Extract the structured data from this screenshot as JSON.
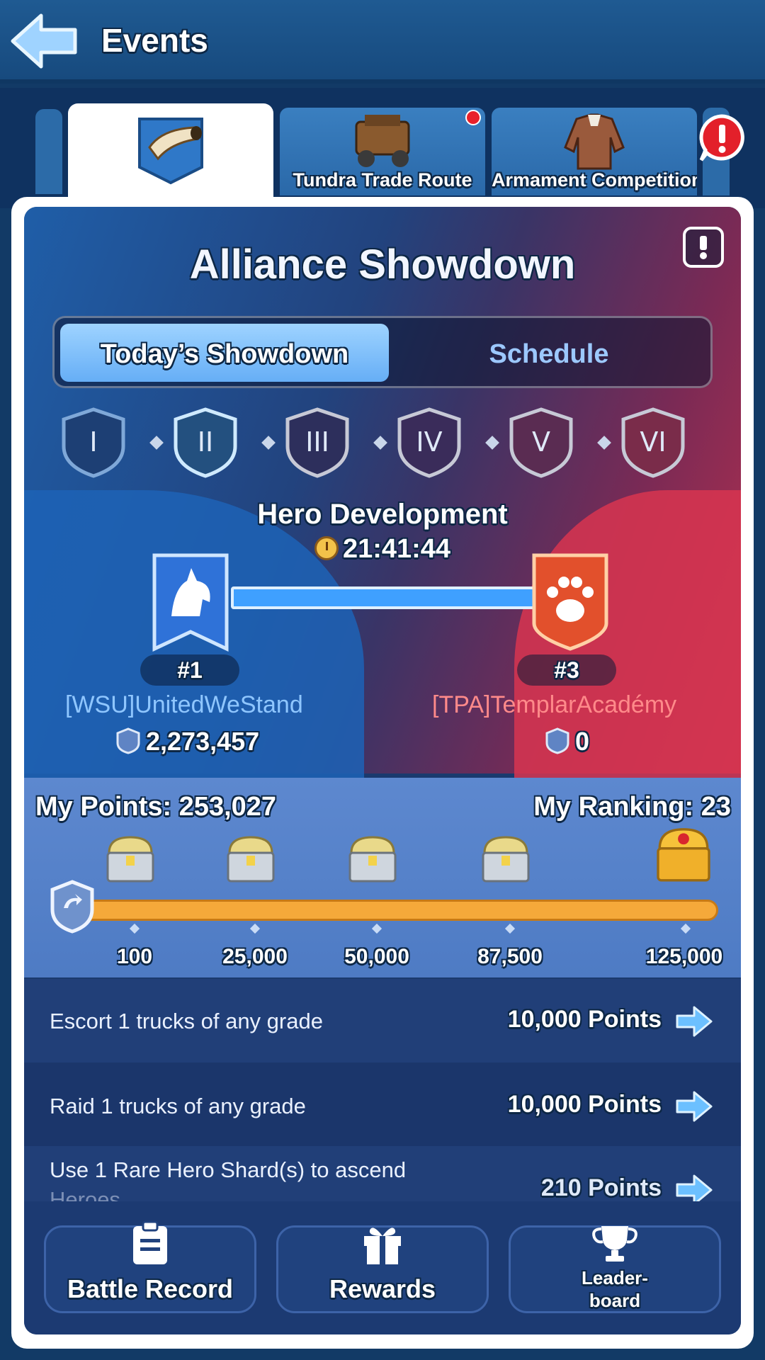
{
  "header": {
    "title": "Events"
  },
  "tabs": [
    {
      "label": "",
      "icon": "horn-icon",
      "active": true
    },
    {
      "label": "Tundra Trade Route",
      "icon": "truck-icon",
      "has_notification": true
    },
    {
      "label": "Armament Competition",
      "icon": "coat-icon"
    }
  ],
  "panel": {
    "title": "Alliance Showdown",
    "toggle": {
      "active": "Today’s Showdown",
      "other": "Schedule"
    },
    "stages": [
      "I",
      "II",
      "III",
      "IV",
      "V",
      "VI"
    ],
    "current_stage": "II",
    "phase": "Hero Development",
    "timer": "21:41:44",
    "left_alliance": {
      "rank": "#1",
      "name": "[WSU]UnitedWeStand",
      "score": "2,273,457"
    },
    "right_alliance": {
      "rank": "#3",
      "name": "[TPA]TemplarAcadémy",
      "score": "0"
    }
  },
  "progress": {
    "my_points_label": "My Points: 253,027",
    "my_ranking_label": "My Ranking: 23",
    "fill_fraction": 1.0,
    "milestones": [
      "100",
      "25,000",
      "50,000",
      "87,500",
      "125,000"
    ]
  },
  "tasks": [
    {
      "text": "Escort 1 trucks of any grade",
      "points": "10,000 Points"
    },
    {
      "text": "Raid 1 trucks of any grade",
      "points": "10,000 Points"
    },
    {
      "text": "Use 1 Rare Hero Shard(s) to ascend",
      "text2": "Heroes",
      "points": "210 Points"
    }
  ],
  "bottom": {
    "battle_record": "Battle Record",
    "rewards": "Rewards",
    "leaderboard_line1": "Leader-",
    "leaderboard_line2": "board"
  },
  "colors": {
    "blue_team": "#1d63b6",
    "red_team": "#d83550",
    "progress_fill": "#f5a93a"
  }
}
